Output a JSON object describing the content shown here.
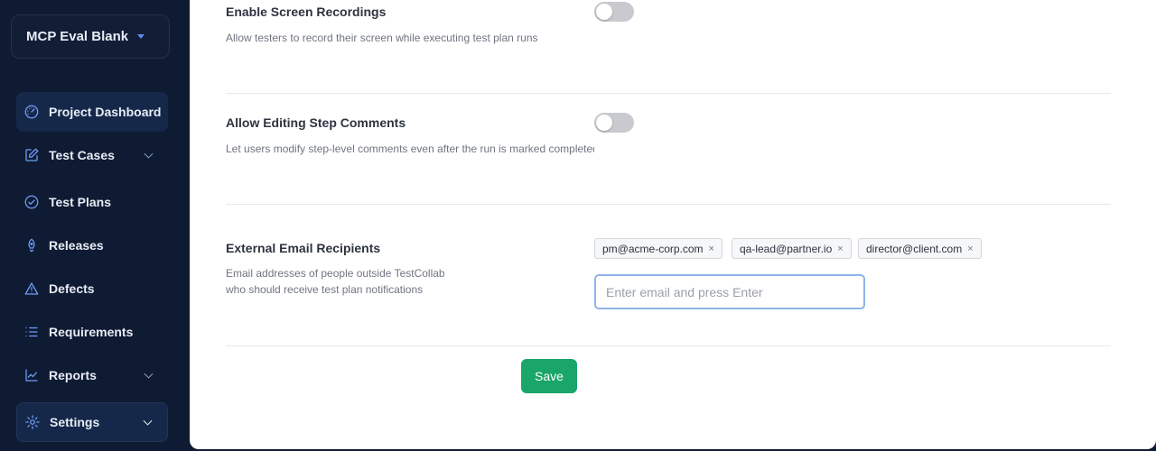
{
  "sidebar": {
    "project_name": "MCP Eval Blank",
    "items": [
      {
        "label": "Project Dashboard",
        "icon": "gauge-icon"
      },
      {
        "label": "Test Cases",
        "icon": "edit-icon"
      },
      {
        "label": "Test Plans",
        "icon": "check-circle-icon"
      },
      {
        "label": "Releases",
        "icon": "rocket-icon"
      },
      {
        "label": "Defects",
        "icon": "warning-icon"
      },
      {
        "label": "Requirements",
        "icon": "list-icon"
      },
      {
        "label": "Reports",
        "icon": "chart-line-icon"
      },
      {
        "label": "Settings",
        "icon": "gear-icon"
      }
    ]
  },
  "settings": {
    "screen_recordings": {
      "title": "Enable Screen Recordings",
      "description": "Allow testers to record their screen while executing test plan runs",
      "enabled": false
    },
    "editing_step_comments": {
      "title": "Allow Editing Step Comments",
      "description": "Let users modify step-level comments even after the run is marked completed",
      "enabled": false
    },
    "external_email": {
      "title": "External Email Recipients",
      "description_line1": "Email addresses of people outside TestCollab",
      "description_line2": "who should receive test plan notifications",
      "recipients": [
        "pm@acme-corp.com",
        "qa-lead@partner.io",
        "director@client.com"
      ],
      "remove_glyph": "×",
      "input_placeholder": "Enter email and press Enter",
      "input_value": ""
    },
    "save_label": "Save"
  },
  "colors": {
    "sidebar_bg": "#0f1b33",
    "accent_icon": "#6f9cf7",
    "save_green": "#1aa56b",
    "toggle_off": "#c8cacf"
  }
}
